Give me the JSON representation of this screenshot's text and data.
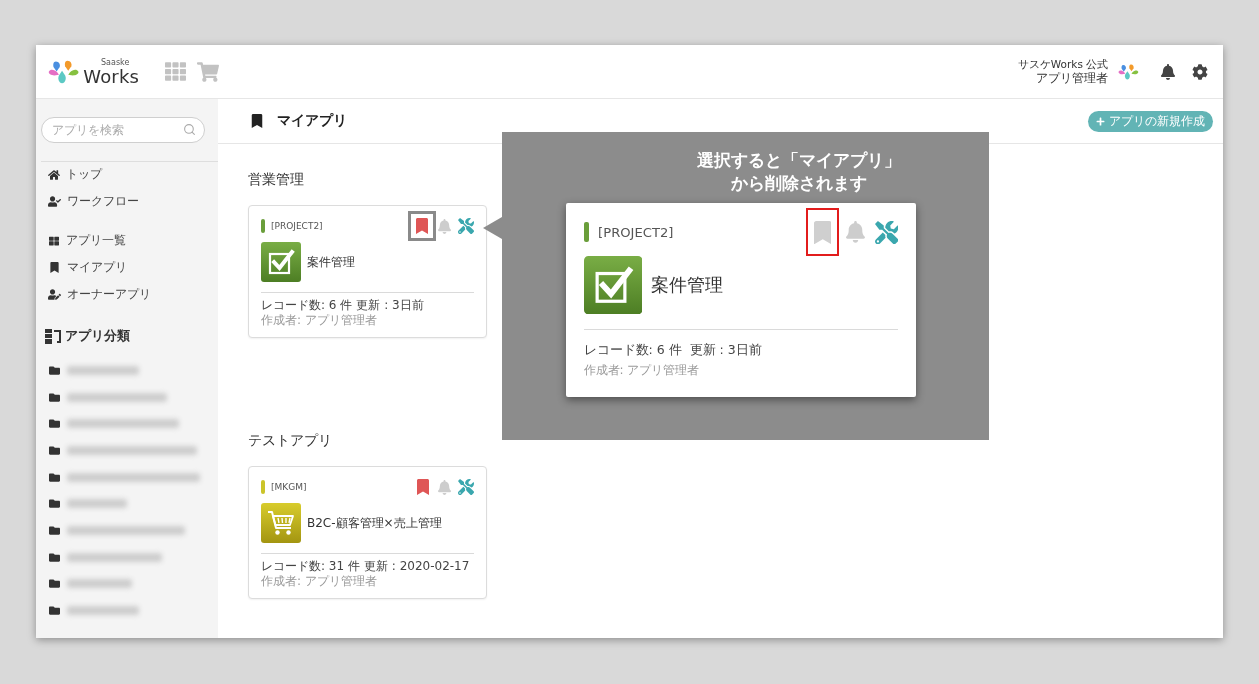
{
  "header": {
    "logo": {
      "tagline": "Saaske",
      "name": "Works"
    },
    "user": {
      "organization": "サスケWorks 公式",
      "role": "アプリ管理者"
    }
  },
  "sidebar": {
    "search": {
      "placeholder": "アプリを検索"
    },
    "nav_groups": [
      {
        "items": [
          {
            "kind": "home",
            "label": "トップ"
          },
          {
            "kind": "workflow",
            "label": "ワークフロー"
          }
        ]
      },
      {
        "items": [
          {
            "kind": "grid",
            "label": "アプリ一覧"
          },
          {
            "kind": "bookmark",
            "label": "マイアプリ"
          },
          {
            "kind": "owner",
            "label": "オーナーアプリ"
          }
        ]
      }
    ],
    "categories": {
      "title": "アプリ分類",
      "items": [
        {
          "blurred": true
        },
        {
          "blurred": true
        },
        {
          "blurred": true
        },
        {
          "blurred": true
        },
        {
          "blurred": true
        },
        {
          "blurred": true
        },
        {
          "blurred": true
        },
        {
          "blurred": true
        },
        {
          "blurred": true
        },
        {
          "blurred": true
        }
      ]
    }
  },
  "main": {
    "title": "マイアプリ",
    "new_app_button": "アプリの新規作成",
    "sections": [
      {
        "title": "営業管理",
        "apps": [
          {
            "code": "[PROJECT2]",
            "color": "#6a9e3a",
            "kind": "check",
            "name": "案件管理",
            "records": "レコード数: 6 件",
            "updated": "更新 : 3日前",
            "author": "作成者: アプリ管理者",
            "bookmarked": true,
            "highlighted": true
          }
        ]
      },
      {
        "title": "テストアプリ",
        "apps": [
          {
            "code": "[MKGM]",
            "color": "#cbc42a",
            "kind": "cart",
            "name": "B2C-顧客管理×売上管理",
            "records": "レコード数: 31 件",
            "updated": "更新 : 2020-02-17",
            "author": "作成者: アプリ管理者",
            "bookmarked": true,
            "highlighted": false
          }
        ]
      }
    ]
  },
  "callout": {
    "lines": [
      "選択すると「マイアプリ」",
      "から削除されます"
    ],
    "card": {
      "code": "[PROJECT2]",
      "color": "#6a9e3a",
      "kind": "check",
      "name": "案件管理",
      "records": "レコード数: 6 件",
      "updated": "更新 : 3日前",
      "author": "作成者: アプリ管理者",
      "bookmarked": false,
      "highlighted": true
    }
  }
}
